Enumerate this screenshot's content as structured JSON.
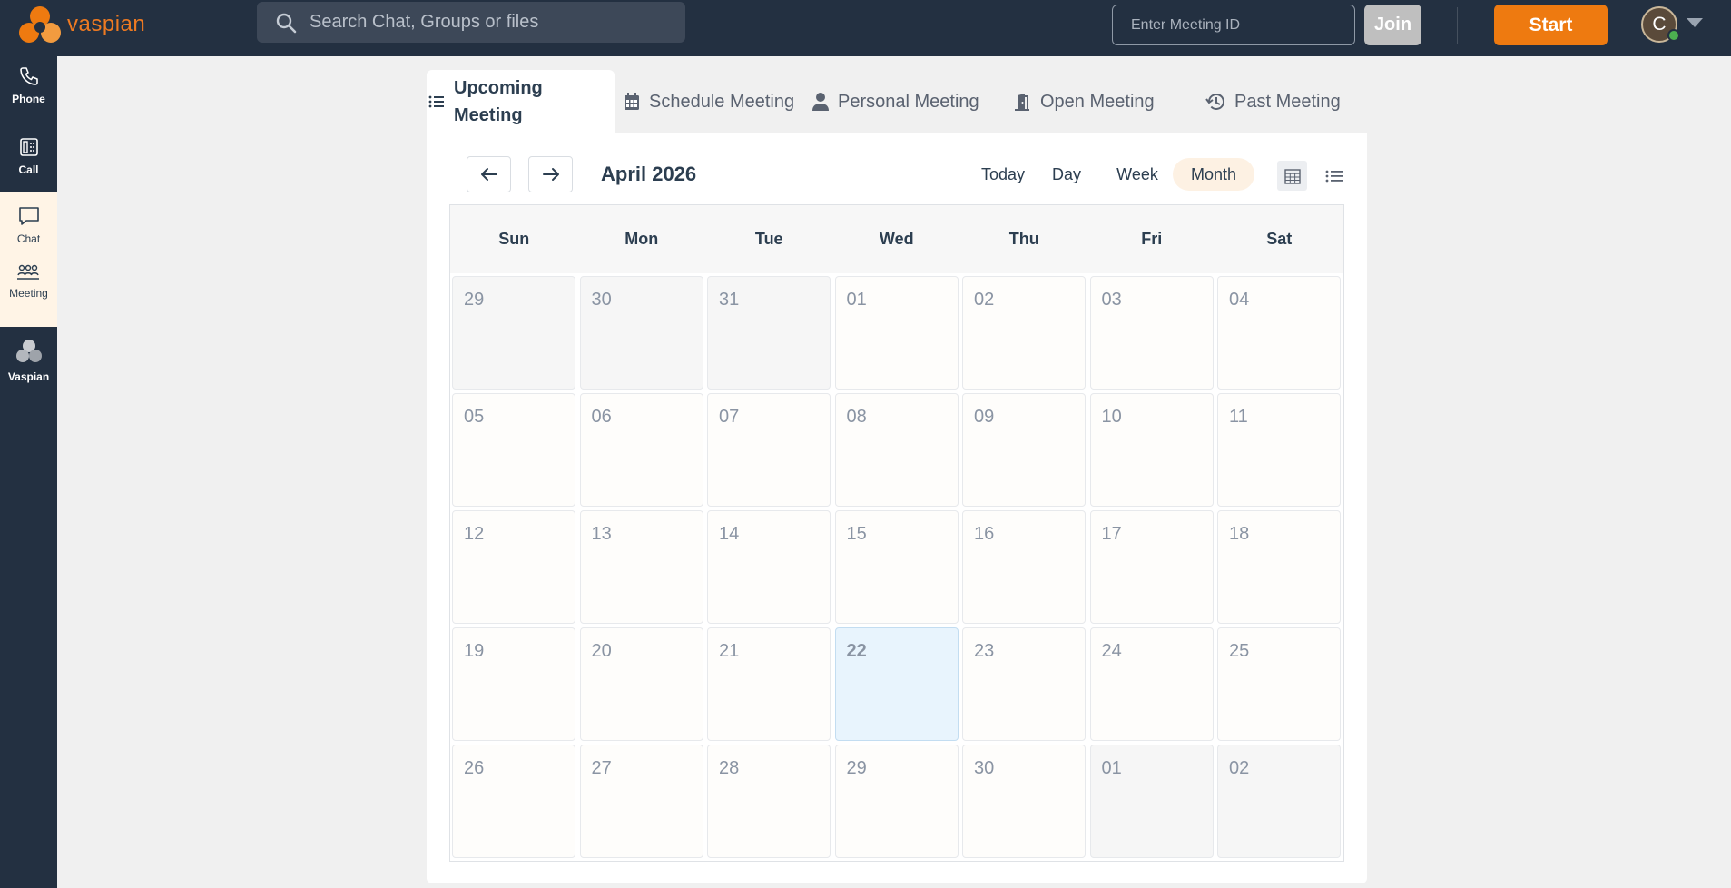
{
  "app": {
    "brand": "vaspian"
  },
  "topbar": {
    "search_placeholder": "Search Chat, Groups or files",
    "meeting_id_placeholder": "Enter Meeting ID",
    "join_label": "Join",
    "start_label": "Start",
    "avatar_initial": "C"
  },
  "sidebar": {
    "items": [
      {
        "label": "Phone",
        "icon": "phone-icon"
      },
      {
        "label": "Call",
        "icon": "call-icon"
      },
      {
        "label": "Chat",
        "icon": "chat-icon"
      },
      {
        "label": "Meeting",
        "icon": "meeting-icon"
      },
      {
        "label": "Vaspian",
        "icon": "vaspian-icon"
      }
    ]
  },
  "tabs": [
    {
      "label": "Upcoming Meeting",
      "icon": "list-icon",
      "active": true
    },
    {
      "label": "Schedule Meeting",
      "icon": "calendar-icon"
    },
    {
      "label": "Personal Meeting",
      "icon": "person-icon"
    },
    {
      "label": "Open Meeting",
      "icon": "door-icon"
    },
    {
      "label": "Past Meeting",
      "icon": "history-icon"
    }
  ],
  "calendar": {
    "title": "April 2026",
    "views": [
      "Today",
      "Day",
      "Week",
      "Month"
    ],
    "active_view": "Month",
    "weekdays": [
      "Sun",
      "Mon",
      "Tue",
      "Wed",
      "Thu",
      "Fri",
      "Sat"
    ],
    "weeks": [
      [
        "29",
        "30",
        "31",
        "01",
        "02",
        "03",
        "04"
      ],
      [
        "05",
        "06",
        "07",
        "08",
        "09",
        "10",
        "11"
      ],
      [
        "12",
        "13",
        "14",
        "15",
        "16",
        "17",
        "18"
      ],
      [
        "19",
        "20",
        "21",
        "22",
        "23",
        "24",
        "25"
      ],
      [
        "26",
        "27",
        "28",
        "29",
        "30",
        "01",
        "02"
      ]
    ],
    "today": "22"
  },
  "colors": {
    "brand_orange": "#ee7a10",
    "nav_bg": "#233041",
    "today_bg": "#e8f4fd"
  }
}
